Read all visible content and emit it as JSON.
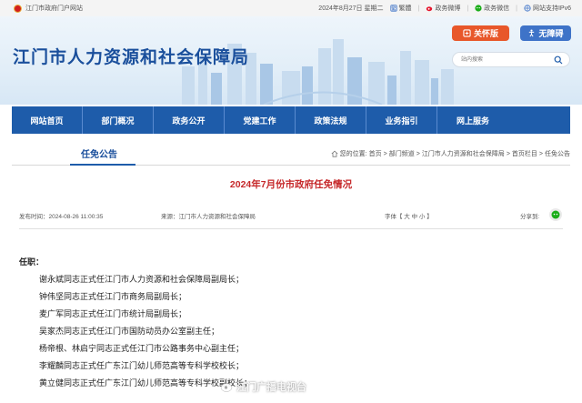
{
  "topbar": {
    "portal_link": "江门市政府门户网站",
    "date": "2024年8月27日 星期二",
    "traditional": "繁體",
    "weibo": "政务微博",
    "wechat": "政务微信",
    "ipv6": "网站支持IPv6"
  },
  "header": {
    "title": "江门市人力资源和社会保障局",
    "elder_label": "关怀版",
    "access_label": "无障碍",
    "search_placeholder": "站内搜索"
  },
  "nav": {
    "items": [
      {
        "label": "网站首页"
      },
      {
        "label": "部门概况"
      },
      {
        "label": "政务公开"
      },
      {
        "label": "党建工作"
      },
      {
        "label": "政策法规"
      },
      {
        "label": "业务指引"
      },
      {
        "label": "网上服务"
      }
    ]
  },
  "section": {
    "name": "任免公告",
    "breadcrumb_prefix": "您的位置:",
    "crumbs": [
      "首页",
      "部门频道",
      "江门市人力资源和社会保障局",
      "首页栏目",
      "任免公告"
    ],
    "sep": ">"
  },
  "article": {
    "title": "2024年7月份市政府任免情况",
    "published": "发布时间：2024-08-26 11:00:35",
    "source": "来源：江门市人力资源和社会保障局",
    "fontsize": "字体【 大  中  小 】",
    "share": "分享到:",
    "lead": "任职：",
    "lines": [
      "谢永斌同志正式任江门市人力资源和社会保障局副局长；",
      "钟伟坚同志正式任江门市商务局副局长；",
      "麦广军同志正式任江门市统计局副局长；",
      "吴家杰同志正式任江门市国防动员办公室副主任；",
      "杨帝根、林启宁同志正式任江门市公路事务中心副主任；",
      "李耀麟同志正式任广东江门幼儿师范高等专科学校校长；",
      "黄立健同志正式任广东江门幼儿师范高等专科学校副校长；"
    ]
  },
  "watermark": "江门广播电视台",
  "colors": {
    "brand": "#1e5caa",
    "title_red": "#c6282a",
    "elder": "#e8572a"
  }
}
